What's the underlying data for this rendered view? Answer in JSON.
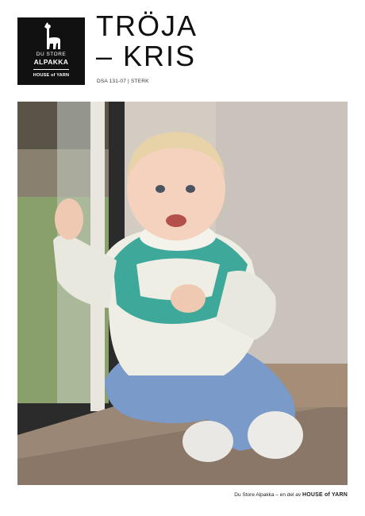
{
  "logo": {
    "line1": "DU STORE",
    "line2": "ALPAKKA",
    "line3": "HOUSE of YARN",
    "icon": "alpaca-icon"
  },
  "title": {
    "line1": "TRÖJA",
    "line2": "– KRIS"
  },
  "subtitle": "DSA 131-07 | STERK",
  "photo": {
    "icon": "photo-child-sweater"
  },
  "footer": {
    "text": "Du Store Alpakka – en del av",
    "brand": "HOUSE of YARN"
  },
  "colors": {
    "logo_bg": "#111111",
    "sweater_teal": "#1f9b8e",
    "sweater_cream": "#efeee5",
    "jeans": "#7a9ac9"
  }
}
